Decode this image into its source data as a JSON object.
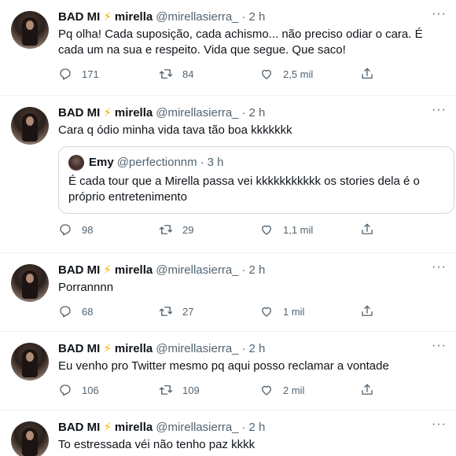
{
  "tweets": [
    {
      "name": "BAD MI",
      "name2": "mirella",
      "handle": "@mirellasierra_",
      "time": "2 h",
      "text": "Pq olha! Cada suposição, cada achismo... não preciso odiar o cara. É cada um na sua e respeito. Vida que segue. Que saco!",
      "replies": "171",
      "retweets": "84",
      "likes": "2,5 mil"
    },
    {
      "name": "BAD MI",
      "name2": "mirella",
      "handle": "@mirellasierra_",
      "time": "2 h",
      "text": "Cara q ódio minha vida tava tão boa kkkkkkk",
      "quote": {
        "name": "Emy",
        "handle": "@perfectionnm",
        "time": "3 h",
        "text": "É cada tour que a Mirella passa vei kkkkkkkkkkk os stories dela é o próprio entretenimento"
      },
      "replies": "98",
      "retweets": "29",
      "likes": "1,1 mil"
    },
    {
      "name": "BAD MI",
      "name2": "mirella",
      "handle": "@mirellasierra_",
      "time": "2 h",
      "text": "Porrannnn",
      "replies": "68",
      "retweets": "27",
      "likes": "1 mil"
    },
    {
      "name": "BAD MI",
      "name2": "mirella",
      "handle": "@mirellasierra_",
      "time": "2 h",
      "text": "Eu venho pro Twitter mesmo pq aqui posso reclamar a vontade",
      "replies": "106",
      "retweets": "109",
      "likes": "2 mil"
    },
    {
      "name": "BAD MI",
      "name2": "mirella",
      "handle": "@mirellasierra_",
      "time": "2 h",
      "text": "To estressada véi não tenho paz kkkk"
    }
  ],
  "icons": {
    "reply": "reply-icon",
    "retweet": "retweet-icon",
    "like": "like-icon",
    "share": "share-icon",
    "more": "more-icon",
    "bolt": "lightning-emoji"
  },
  "colors": {
    "text": "#0f1419",
    "muted": "#536471",
    "border": "#eff3f4",
    "bolt": "#f7b500"
  }
}
